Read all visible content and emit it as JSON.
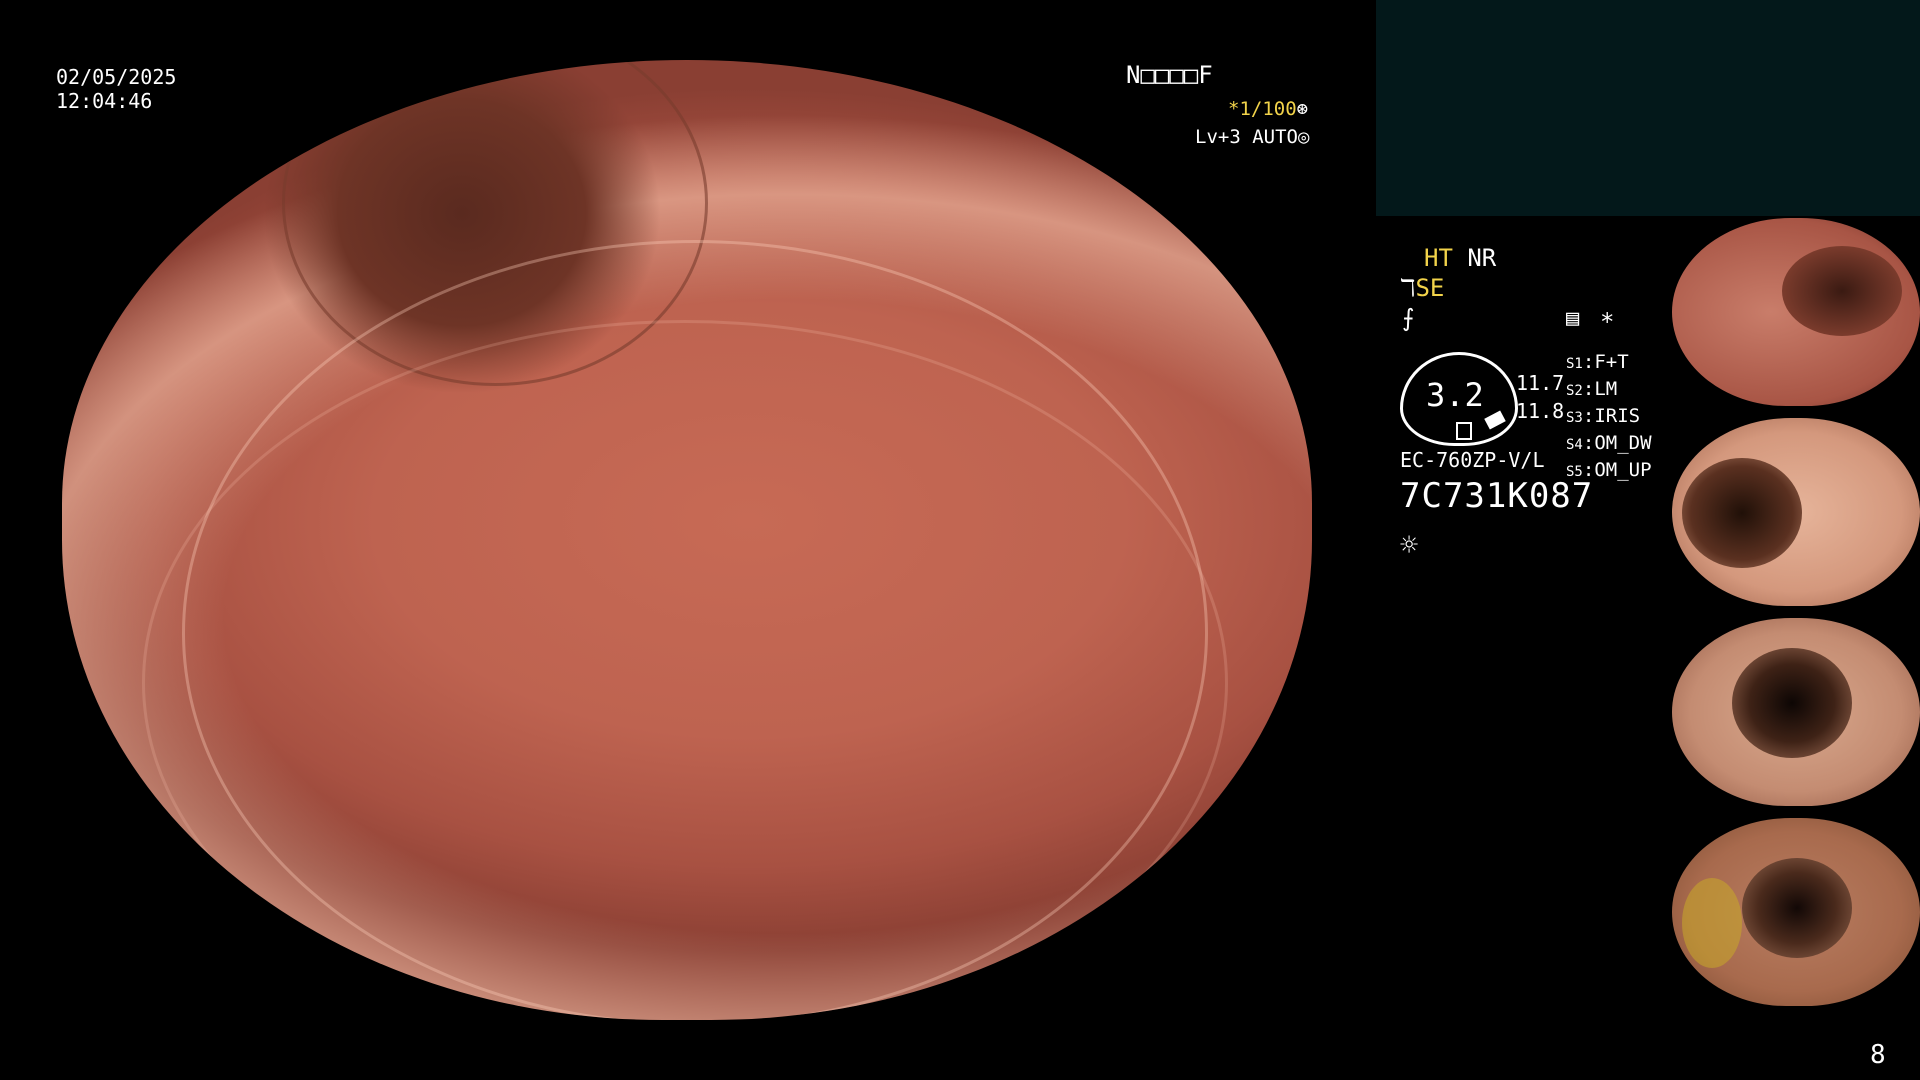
{
  "overlay": {
    "date": "02/05/2025",
    "time": "12:04:46",
    "mode_code": "N□□□□F",
    "shutter": "*1/100",
    "shutter_icon": "⊛",
    "level": "Lv+3 AUTO",
    "level_icon": "◎"
  },
  "status": {
    "ht": "HT",
    "nr": "NR",
    "se": "SE",
    "se_icon": "ℸ",
    "f_icon": "⨍",
    "memo_icon": "▤",
    "star": "*",
    "zoom_value": "3.2",
    "num_a": "11.7",
    "num_b": "11.8",
    "scope_model": "EC-760ZP-V/L",
    "serial": "7C731K087",
    "light_icon": "☼"
  },
  "switches": [
    {
      "key": "S1",
      "value": "F+T"
    },
    {
      "key": "S2",
      "value": "LM"
    },
    {
      "key": "S3",
      "value": "IRIS"
    },
    {
      "key": "S4",
      "value": "OM_DW"
    },
    {
      "key": "S5",
      "value": "OM_UP"
    }
  ],
  "page_number": "8",
  "colors": {
    "highlight_yellow": "#f2d34a",
    "panel_teal": "#03181a"
  }
}
